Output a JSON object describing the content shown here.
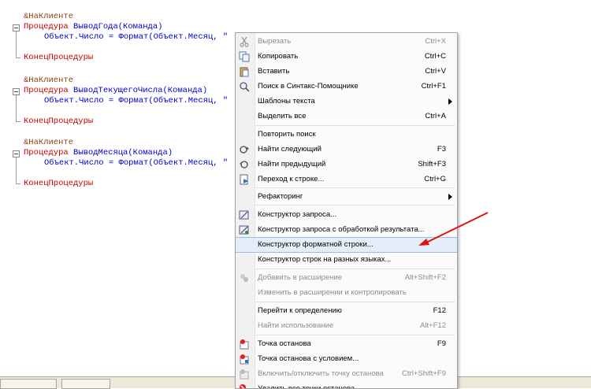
{
  "code": {
    "blocks": [
      {
        "annotation": "&НаКлиенте",
        "proc_keyword": "Процедура",
        "proc_name": "ВыводГода",
        "proc_args": "(Команда)",
        "body": "Объект.Число = Формат(Объект.Месяц, \"",
        "end": "КонецПроцедуры"
      },
      {
        "annotation": "&НаКлиенте",
        "proc_keyword": "Процедура",
        "proc_name": "ВыводТекущегоЧисла",
        "proc_args": "(Команда)",
        "body": "Объект.Число = Формат(Объект.Месяц, \"",
        "end": "КонецПроцедуры"
      },
      {
        "annotation": "&НаКлиенте",
        "proc_keyword": "Процедура",
        "proc_name": "ВыводМесяца",
        "proc_args": "(Команда)",
        "body": "Объект.Число = Формат(Объект.Месяц, \"",
        "end": "КонецПроцедуры"
      }
    ]
  },
  "context_menu": {
    "items": [
      {
        "label": "Вырезать",
        "shortcut": "Ctrl+X",
        "icon": "scissors-icon",
        "disabled": true
      },
      {
        "label": "Копировать",
        "shortcut": "Ctrl+C",
        "icon": "copy-icon",
        "disabled": false
      },
      {
        "label": "Вставить",
        "shortcut": "Ctrl+V",
        "icon": "paste-icon",
        "disabled": false
      },
      {
        "label": "Поиск в Синтакс-Помощнике",
        "shortcut": "Ctrl+F1",
        "icon": "syntax-search-icon",
        "disabled": false
      },
      {
        "label": "Шаблоны текста",
        "shortcut": "",
        "icon": "",
        "disabled": false,
        "submenu": true
      },
      {
        "label": "Выделить все",
        "shortcut": "Ctrl+A",
        "icon": "",
        "disabled": false
      },
      {
        "label": "Повторить поиск",
        "shortcut": "",
        "icon": "",
        "disabled": false
      },
      {
        "label": "Найти следующий",
        "shortcut": "F3",
        "icon": "find-next-icon",
        "disabled": false
      },
      {
        "label": "Найти предыдущий",
        "shortcut": "Shift+F3",
        "icon": "find-prev-icon",
        "disabled": false
      },
      {
        "label": "Переход к строке...",
        "shortcut": "Ctrl+G",
        "icon": "goto-line-icon",
        "disabled": false
      },
      {
        "label": "Рефакторинг",
        "shortcut": "",
        "icon": "",
        "disabled": false,
        "submenu": true
      },
      {
        "label": "Конструктор запроса...",
        "shortcut": "",
        "icon": "query-builder-icon",
        "disabled": false
      },
      {
        "label": "Конструктор запроса с обработкой результата...",
        "shortcut": "",
        "icon": "query-builder-result-icon",
        "disabled": false
      },
      {
        "label": "Конструктор форматной строки...",
        "shortcut": "",
        "icon": "",
        "disabled": false,
        "highlighted": true
      },
      {
        "label": "Конструктор строк на разных языках...",
        "shortcut": "",
        "icon": "",
        "disabled": false
      },
      {
        "label": "Добавить в расширение",
        "shortcut": "Alt+Shift+F2",
        "icon": "extension-icon",
        "disabled": true
      },
      {
        "label": "Изменить в расширении и контролировать",
        "shortcut": "",
        "icon": "",
        "disabled": true
      },
      {
        "label": "Перейти к определению",
        "shortcut": "F12",
        "icon": "",
        "disabled": false
      },
      {
        "label": "Найти использование",
        "shortcut": "Alt+F12",
        "icon": "",
        "disabled": true
      },
      {
        "label": "Точка останова",
        "shortcut": "F9",
        "icon": "breakpoint-icon",
        "disabled": false
      },
      {
        "label": "Точка останова с условием...",
        "shortcut": "",
        "icon": "conditional-breakpoint-icon",
        "disabled": false
      },
      {
        "label": "Включить/отключить точку останова",
        "shortcut": "Ctrl+Shift+F9",
        "icon": "toggle-breakpoint-icon",
        "disabled": true
      },
      {
        "label": "Удалить все точки останова",
        "shortcut": "",
        "icon": "delete-breakpoints-icon",
        "disabled": false
      }
    ]
  },
  "colors": {
    "annotation": "#8b4513",
    "keyword": "#cc0000",
    "identifier": "#0000cc",
    "highlight": "#e3eef9",
    "arrow": "#e21010"
  }
}
